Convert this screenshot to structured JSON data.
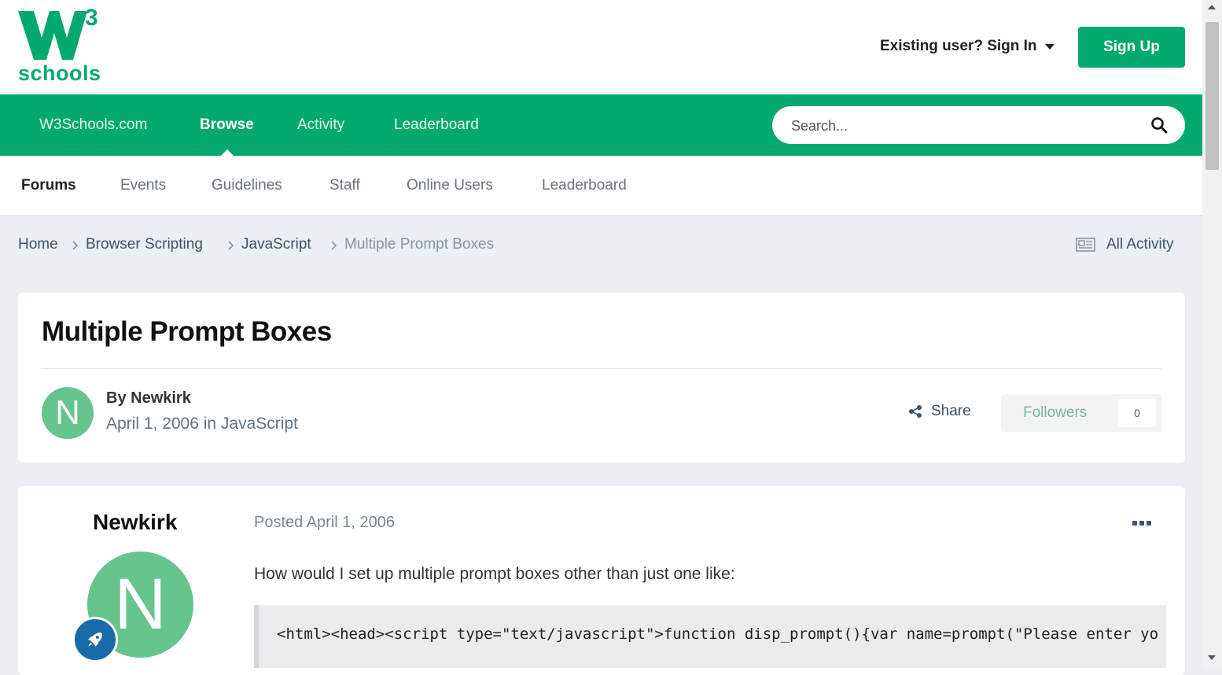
{
  "header": {
    "logo_superscript": "3",
    "logo_text": "schools",
    "signin_label": "Existing user? Sign In",
    "signup_label": "Sign Up"
  },
  "main_nav": {
    "items": [
      {
        "label": "W3Schools.com"
      },
      {
        "label": "Browse"
      },
      {
        "label": "Activity"
      },
      {
        "label": "Leaderboard"
      }
    ],
    "active": "Browse"
  },
  "search": {
    "placeholder": "Search..."
  },
  "sub_nav": {
    "items": [
      {
        "label": "Forums"
      },
      {
        "label": "Events"
      },
      {
        "label": "Guidelines"
      },
      {
        "label": "Staff"
      },
      {
        "label": "Online Users"
      },
      {
        "label": "Leaderboard"
      }
    ],
    "active": "Forums"
  },
  "breadcrumb": {
    "items": [
      "Home",
      "Browser Scripting",
      "JavaScript",
      "Multiple Prompt Boxes"
    ],
    "all_activity_label": "All Activity"
  },
  "topic": {
    "title": "Multiple Prompt Boxes",
    "author_initial": "N",
    "by_line": "By Newkirk",
    "meta_line": "April 1, 2006 in JavaScript",
    "share_label": "Share",
    "followers_label": "Followers",
    "followers_count": "0"
  },
  "post": {
    "author_name": "Newkirk",
    "author_initial": "N",
    "posted": "Posted April 1, 2006",
    "body": "How would I set up multiple prompt boxes other than just one like:",
    "code": "<html><head><script type=\"text/javascript\">function disp_prompt(){var name=prompt(\"Please enter yo"
  },
  "colors": {
    "brand_green": "#04aa6d",
    "avatar_green": "#66c48c",
    "rank_blue": "#1a6aa8"
  }
}
